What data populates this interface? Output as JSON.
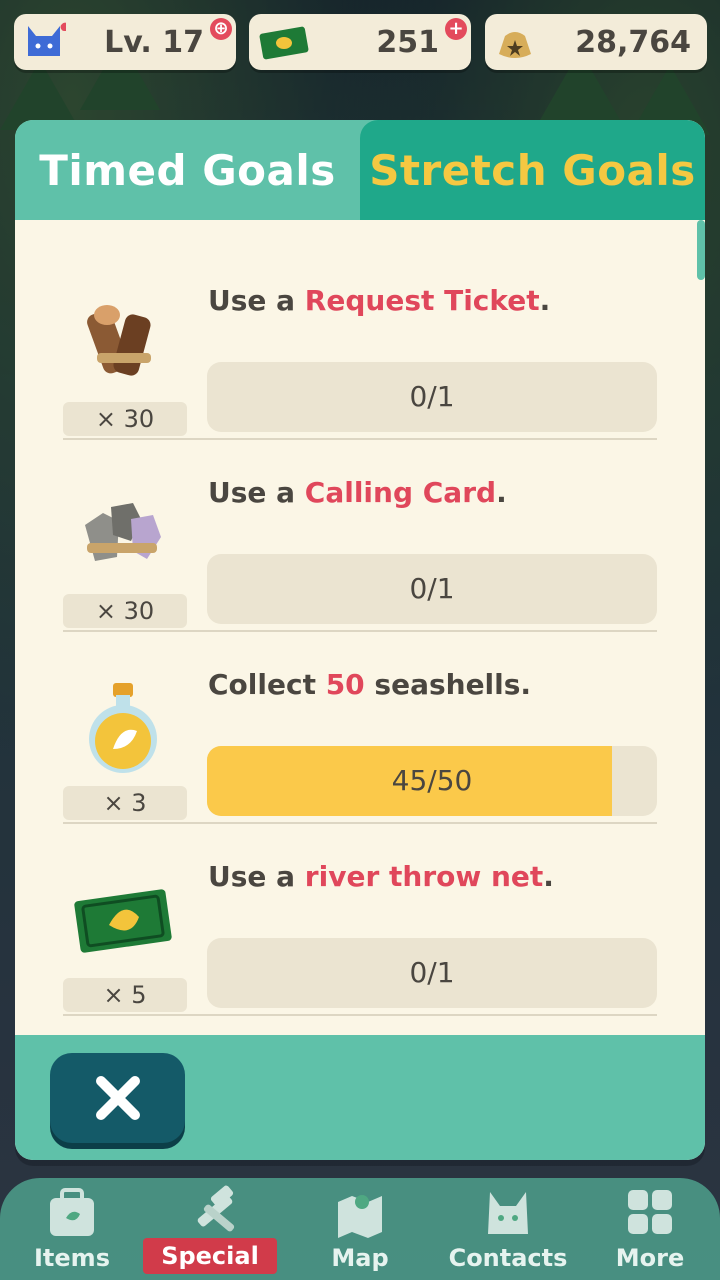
{
  "hud": {
    "level": "Lv. 17",
    "tickets": "251",
    "bells": "28,764"
  },
  "modal": {
    "tabs": [
      {
        "label": "Timed Goals",
        "active": false
      },
      {
        "label": "Stretch Goals",
        "active": true
      }
    ],
    "goals": [
      {
        "prefix": "Use a ",
        "highlight": "Request Ticket",
        "suffix": ".",
        "reward_qty": "× 30",
        "reward_icon": "wood-bundle-icon",
        "progress_label": "0/1",
        "progress_fraction": 0
      },
      {
        "prefix": "Use a ",
        "highlight": "Calling Card",
        "suffix": ".",
        "reward_qty": "× 30",
        "reward_icon": "stone-bundle-icon",
        "progress_label": "0/1",
        "progress_fraction": 0
      },
      {
        "prefix": "Collect ",
        "highlight": "50",
        "suffix": " seashells.",
        "reward_qty": "× 3",
        "reward_icon": "essence-bottle-icon",
        "progress_label": "45/50",
        "progress_fraction": 0.9
      },
      {
        "prefix": "Use a ",
        "highlight": "river throw net",
        "suffix": ".",
        "reward_qty": "× 5",
        "reward_icon": "leaf-ticket-icon",
        "progress_label": "0/1",
        "progress_fraction": 0
      }
    ]
  },
  "nav": {
    "items": [
      {
        "label": "Items",
        "icon": "bag-icon"
      },
      {
        "label": "Special",
        "icon": "tools-icon"
      },
      {
        "label": "Map",
        "icon": "map-icon"
      },
      {
        "label": "Contacts",
        "icon": "cat-face-icon"
      },
      {
        "label": "More",
        "icon": "grid-icon"
      }
    ]
  },
  "colors": {
    "teal": "#5fc1a9",
    "teal_dark": "#1fa88a",
    "highlight": "#e0475b",
    "progress_fill": "#fbc94a",
    "gold": "#f5c842"
  }
}
